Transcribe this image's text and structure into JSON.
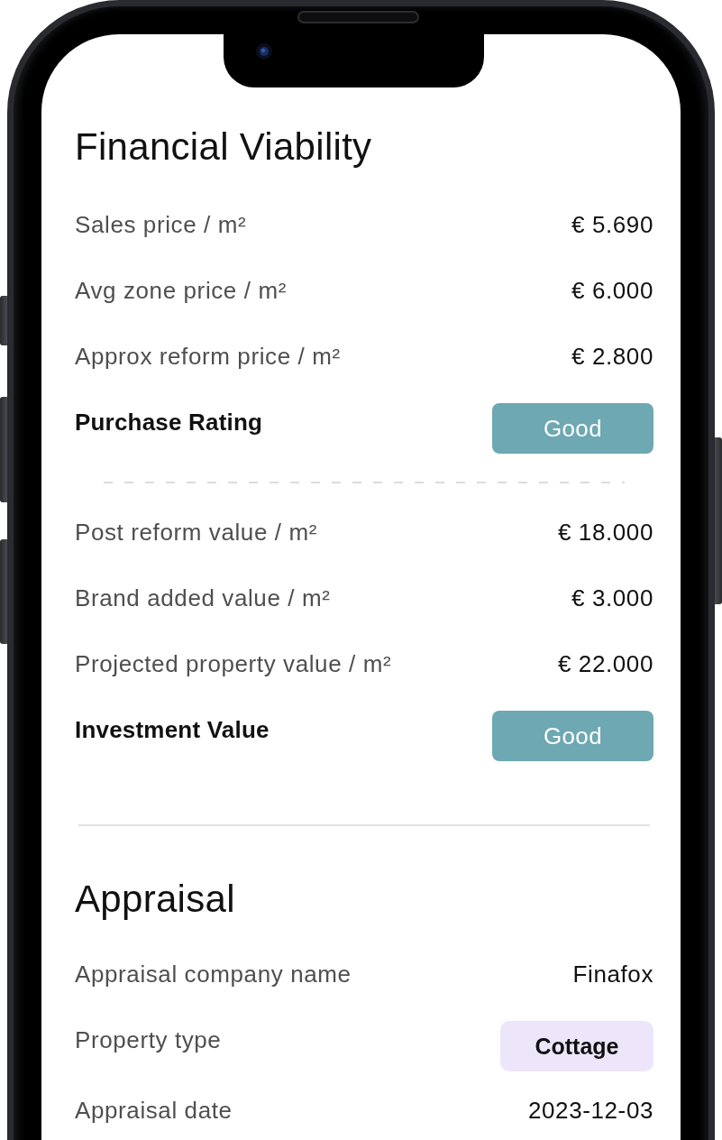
{
  "screen": {
    "sections": [
      {
        "title": "Financial Viability",
        "groups": [
          {
            "rows": [
              {
                "kind": "value",
                "label": "Sales price / m²",
                "value": "€ 5.690"
              },
              {
                "kind": "value",
                "label": "Avg zone price / m²",
                "value": "€ 6.000"
              },
              {
                "kind": "value",
                "label": "Approx reform price / m²",
                "value": "€ 2.800"
              },
              {
                "kind": "rating",
                "label": "Purchase Rating",
                "value": "Good"
              }
            ]
          },
          {
            "rows": [
              {
                "kind": "value",
                "label": "Post reform value / m²",
                "value": "€ 18.000"
              },
              {
                "kind": "value",
                "label": "Brand added value / m²",
                "value": "€ 3.000"
              },
              {
                "kind": "value",
                "label": "Projected property value / m²",
                "value": "€ 22.000"
              },
              {
                "kind": "rating",
                "label": "Investment Value",
                "value": "Good"
              }
            ]
          }
        ]
      },
      {
        "title": "Appraisal",
        "groups": [
          {
            "rows": [
              {
                "kind": "value",
                "label": "Appraisal company name",
                "value": "Finafox"
              },
              {
                "kind": "tag",
                "label": "Property type",
                "value": "Cottage"
              },
              {
                "kind": "value",
                "label": "Appraisal date",
                "value": "2023-12-03"
              }
            ]
          }
        ]
      }
    ]
  }
}
